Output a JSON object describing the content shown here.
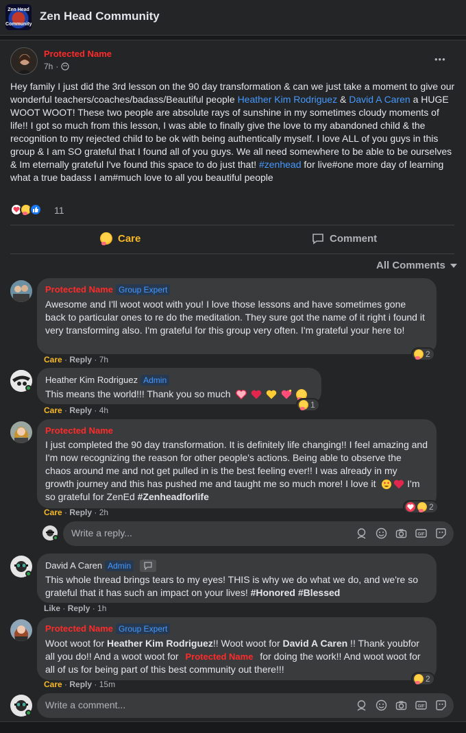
{
  "group": {
    "logo_text_top": "Zen Head",
    "logo_text_bottom": "Community",
    "name": "Zen Head Community"
  },
  "post": {
    "author": "Protected Name",
    "time": "7h",
    "more_label": "•••",
    "text_part1": "Hey family I just did the 3rd lesson on the 90 day transformation & can we just take a moment to give our wonderful teachers/coaches/badass/Beautiful people ",
    "mention1": "Heather Kim Rodriguez",
    "amp": " & ",
    "mention2": "David A Caren",
    "text_part2": " a HUGE WOOT WOOT! These two people are absolute rays of sunshine in my sometimes cloudy moments of life!! I got so much from this lesson, I was able to finally give the love to my abandoned child & the recognition to my rejected child to be ok with being authentically myself. I love ALL of you guys in this group & I am SO grateful that I found all of you guys. We all need somewhere to be able to be ourselves & Im eternally grateful I've found this space to do just that! ",
    "hashtag": "#zenhead",
    "text_part3": " for live#one more day of learning what a true badass I am#much love to all you beautiful people",
    "reaction_count": "11",
    "care_label": "Care",
    "comment_label": "Comment"
  },
  "comments_filter": "All Comments",
  "comments": [
    {
      "author": "Protected Name",
      "badge": "Group Expert",
      "text": "Awesome and I'll woot woot with you! I love those lessons and have sometimes gone back to particular ones to re do the meditation. They sure got the name of it right i found it very transforming also. I'm grateful for this group very often. I'm grateful your here to!",
      "reaction_label": "Care",
      "reply_label": "Reply",
      "time": "7h",
      "reaction_count": "2"
    },
    {
      "author": "Heather Kim Rodriguez",
      "badge": "Admin",
      "text": "This means the world!!! Thank you so much",
      "reaction_label": "Care",
      "reply_label": "Reply",
      "time": "4h",
      "reaction_count": "1"
    },
    {
      "author": "Protected Name",
      "text": "I just completed the 90 day transformation. It is definitely life changing!! I feel amazing and I'm now recognizing the reason for other people's actions. Being able to observe the chaos around me and not get pulled in is the best feeling ever!! I was already in my growth journey and this has pushed me and taught me so much more! I love it",
      "text_end": " I'm so grateful for ZenEd ",
      "hashtag": "#Zenheadforlife",
      "reaction_label": "Care",
      "reply_label": "Reply",
      "time": "2h",
      "reaction_count": "2"
    },
    {
      "author": "David A Caren",
      "badge": "Admin",
      "text": "This whole thread brings tears to my eyes! THIS is why we do what we do, and we're so grateful that it has such an impact on your lives! ",
      "hashtags": "#Honored #Blessed",
      "reaction_label": "Like",
      "reply_label": "Reply",
      "time": "1h"
    },
    {
      "author": "Protected Name",
      "badge": "Group Expert",
      "text_a": "Woot woot for ",
      "mention1": "Heather Kim Rodriguez",
      "text_b": "!! Woot woot for ",
      "mention2": "David A Caren",
      "text_c": " !! Thank youbfor all you do!! And a woot woot for ",
      "mention3": "Protected Name",
      "text_d": " for doing the work!! And woot woot for all of us for being part of this best community out there!!!",
      "reaction_label": "Care",
      "reply_label": "Reply",
      "time": "15m",
      "reaction_count": "2"
    }
  ],
  "reply_placeholder": "Write a reply...",
  "comment_placeholder": "Write a comment...",
  "separator": " · ",
  "colors": {
    "background": "#18191a",
    "card": "#242526",
    "bubble": "#3a3b3c",
    "protected_name": "#ff2a2a",
    "link": "#4599ff",
    "care": "#f7b928"
  }
}
